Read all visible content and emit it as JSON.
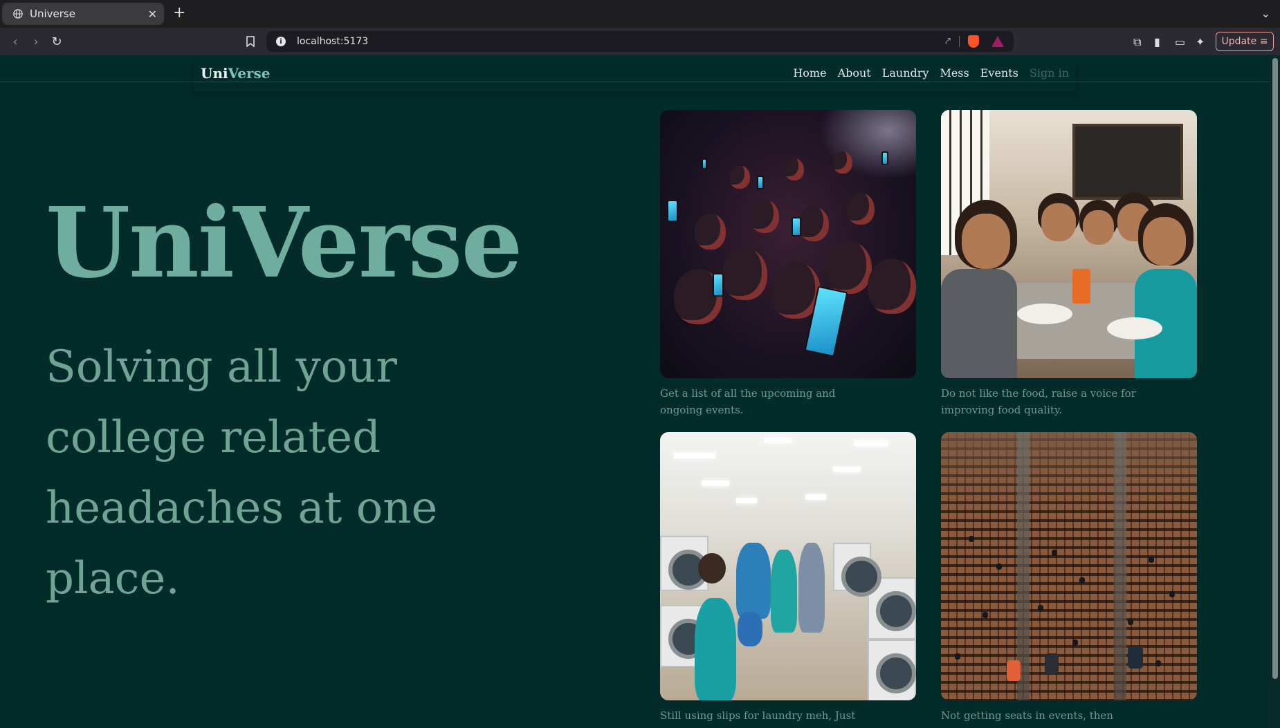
{
  "browser": {
    "tab_title": "Universe",
    "url": "localhost:5173",
    "update_label": "Update"
  },
  "nav": {
    "brand_uni": "Uni",
    "brand_verse": "Verse",
    "links": [
      "Home",
      "About",
      "Laundry",
      "Mess",
      "Events",
      "Sign in"
    ]
  },
  "hero": {
    "title": "UniVerse",
    "subtitle": "Solving all your college related headaches at one place."
  },
  "cards": [
    {
      "image": "concert-crowd-phones",
      "caption": "Get a list of all the upcoming and ongoing events."
    },
    {
      "image": "students-eating-mess",
      "caption": "Do not like the food, raise a voice for improving food quality."
    },
    {
      "image": "students-laundry-room",
      "caption": "Still using slips for laundry meh, Just digitalize the slip."
    },
    {
      "image": "auditorium-seats",
      "caption": "Not getting seats in events, then prebook your seats."
    }
  ],
  "colors": {
    "page_bg": "#032b2a",
    "brand_accent": "#7fc4b6",
    "hero_title": "#6fae9f",
    "caption": "#6e9a94"
  }
}
